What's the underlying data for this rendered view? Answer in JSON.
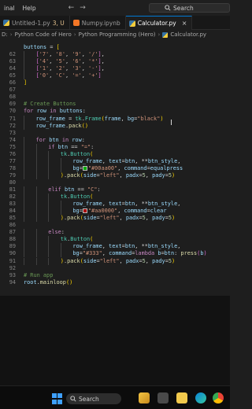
{
  "titlebar": {
    "menu": [
      "inal",
      "Help"
    ],
    "search_label": "Search"
  },
  "tabs": [
    {
      "label": "Untitled-1.py",
      "modified": "3, U",
      "active": false,
      "type": "py"
    },
    {
      "label": "Numpy.ipynb",
      "modified": "",
      "active": false,
      "type": "nb"
    },
    {
      "label": "Calculator.py",
      "modified": "",
      "active": true,
      "type": "py"
    }
  ],
  "tab_close_glyph": "×",
  "breadcrumb": [
    "D:",
    "Python Code of Hero",
    "Python Programming (Hero)",
    "Calculator.py"
  ],
  "colors": {
    "equal_swatch": "#00aa00",
    "clear_swatch": "#aa0000"
  },
  "code_lines": [
    {
      "n": "",
      "indent": 0,
      "tokens": [
        [
          "var",
          "buttons"
        ],
        [
          "op",
          " = "
        ],
        [
          "br1",
          "["
        ]
      ]
    },
    {
      "n": "62",
      "indent": 1,
      "tokens": [
        [
          "br2",
          "["
        ],
        [
          "str",
          "'7'"
        ],
        [
          "op",
          ", "
        ],
        [
          "str",
          "'8'"
        ],
        [
          "op",
          ", "
        ],
        [
          "str",
          "'9'"
        ],
        [
          "op",
          ", "
        ],
        [
          "str",
          "'/'"
        ],
        [
          "br2",
          "]"
        ],
        [
          "op",
          ","
        ]
      ]
    },
    {
      "n": "63",
      "indent": 1,
      "tokens": [
        [
          "br2",
          "["
        ],
        [
          "str",
          "'4'"
        ],
        [
          "op",
          ", "
        ],
        [
          "str",
          "'5'"
        ],
        [
          "op",
          ", "
        ],
        [
          "str",
          "'6'"
        ],
        [
          "op",
          ", "
        ],
        [
          "str",
          "'*'"
        ],
        [
          "br2",
          "]"
        ],
        [
          "op",
          ","
        ]
      ]
    },
    {
      "n": "64",
      "indent": 1,
      "tokens": [
        [
          "br2",
          "["
        ],
        [
          "str",
          "'1'"
        ],
        [
          "op",
          ", "
        ],
        [
          "str",
          "'2'"
        ],
        [
          "op",
          ", "
        ],
        [
          "str",
          "'3'"
        ],
        [
          "op",
          ", "
        ],
        [
          "str",
          "'-'"
        ],
        [
          "br2",
          "]"
        ],
        [
          "op",
          ","
        ]
      ]
    },
    {
      "n": "65",
      "indent": 1,
      "tokens": [
        [
          "br2",
          "["
        ],
        [
          "str",
          "'0'"
        ],
        [
          "op",
          ", "
        ],
        [
          "str",
          "'C'"
        ],
        [
          "op",
          ", "
        ],
        [
          "str",
          "'='"
        ],
        [
          "op",
          ", "
        ],
        [
          "str",
          "'+'"
        ],
        [
          "br2",
          "]"
        ]
      ]
    },
    {
      "n": "66",
      "indent": 0,
      "tokens": [
        [
          "br1",
          "]"
        ]
      ]
    },
    {
      "n": "67",
      "indent": 0,
      "tokens": []
    },
    {
      "n": "68",
      "indent": 0,
      "tokens": []
    },
    {
      "n": "69",
      "indent": 0,
      "tokens": [
        [
          "com",
          "# Create Buttons"
        ]
      ]
    },
    {
      "n": "70",
      "indent": 0,
      "tokens": [
        [
          "kw",
          "for"
        ],
        [
          "op",
          " "
        ],
        [
          "var",
          "row"
        ],
        [
          "op",
          " "
        ],
        [
          "kw",
          "in"
        ],
        [
          "op",
          " "
        ],
        [
          "var",
          "buttons"
        ],
        [
          "op",
          ":"
        ]
      ]
    },
    {
      "n": "71",
      "indent": 1,
      "tokens": [
        [
          "var",
          "row_frame"
        ],
        [
          "op",
          " = "
        ],
        [
          "cls",
          "tk"
        ],
        [
          "op",
          "."
        ],
        [
          "cls",
          "Frame"
        ],
        [
          "br1",
          "("
        ],
        [
          "var",
          "frame"
        ],
        [
          "op",
          ", "
        ],
        [
          "var",
          "bg"
        ],
        [
          "op",
          "="
        ],
        [
          "str",
          "\"black\""
        ],
        [
          "br1",
          ")"
        ]
      ]
    },
    {
      "n": "72",
      "indent": 1,
      "tokens": [
        [
          "var",
          "row_frame"
        ],
        [
          "op",
          "."
        ],
        [
          "fn",
          "pack"
        ],
        [
          "br1",
          "()"
        ]
      ]
    },
    {
      "n": "73",
      "indent": 0,
      "tokens": []
    },
    {
      "n": "74",
      "indent": 1,
      "tokens": [
        [
          "kw",
          "for"
        ],
        [
          "op",
          " "
        ],
        [
          "var",
          "btn"
        ],
        [
          "op",
          " "
        ],
        [
          "kw",
          "in"
        ],
        [
          "op",
          " "
        ],
        [
          "var",
          "row"
        ],
        [
          "op",
          ":"
        ]
      ]
    },
    {
      "n": "75",
      "indent": 2,
      "tokens": [
        [
          "kw",
          "if"
        ],
        [
          "op",
          " "
        ],
        [
          "var",
          "btn"
        ],
        [
          "op",
          " == "
        ],
        [
          "str",
          "\"=\""
        ],
        [
          "op",
          ":"
        ]
      ]
    },
    {
      "n": "76",
      "indent": 3,
      "tokens": [
        [
          "cls",
          "tk"
        ],
        [
          "op",
          "."
        ],
        [
          "cls",
          "Button"
        ],
        [
          "br1",
          "("
        ]
      ]
    },
    {
      "n": "77",
      "indent": 4,
      "tokens": [
        [
          "var",
          "row_frame"
        ],
        [
          "op",
          ", "
        ],
        [
          "var",
          "text"
        ],
        [
          "op",
          "="
        ],
        [
          "var",
          "btn"
        ],
        [
          "op",
          ", **"
        ],
        [
          "var",
          "btn_style"
        ],
        [
          "op",
          ","
        ]
      ]
    },
    {
      "n": "78",
      "indent": 4,
      "tokens": [
        [
          "var",
          "bg"
        ],
        [
          "op",
          "="
        ],
        [
          "swatch",
          "equal_swatch"
        ],
        [
          "str",
          "\"#00aa00\""
        ],
        [
          "op",
          ", "
        ],
        [
          "var",
          "command"
        ],
        [
          "op",
          "="
        ],
        [
          "var",
          "equalpress"
        ]
      ]
    },
    {
      "n": "79",
      "indent": 3,
      "tokens": [
        [
          "br1",
          ")"
        ],
        [
          "op",
          "."
        ],
        [
          "fn",
          "pack"
        ],
        [
          "br1",
          "("
        ],
        [
          "var",
          "side"
        ],
        [
          "op",
          "="
        ],
        [
          "str",
          "\"left\""
        ],
        [
          "op",
          ", "
        ],
        [
          "var",
          "padx"
        ],
        [
          "op",
          "="
        ],
        [
          "num",
          "5"
        ],
        [
          "op",
          ", "
        ],
        [
          "var",
          "pady"
        ],
        [
          "op",
          "="
        ],
        [
          "num",
          "5"
        ],
        [
          "br1",
          ")"
        ]
      ]
    },
    {
      "n": "80",
      "indent": 0,
      "tokens": []
    },
    {
      "n": "81",
      "indent": 2,
      "tokens": [
        [
          "kw",
          "elif"
        ],
        [
          "op",
          " "
        ],
        [
          "var",
          "btn"
        ],
        [
          "op",
          " == "
        ],
        [
          "str",
          "\"C\""
        ],
        [
          "op",
          ":"
        ]
      ]
    },
    {
      "n": "82",
      "indent": 3,
      "tokens": [
        [
          "cls",
          "tk"
        ],
        [
          "op",
          "."
        ],
        [
          "cls",
          "Button"
        ],
        [
          "br1",
          "("
        ]
      ]
    },
    {
      "n": "83",
      "indent": 4,
      "tokens": [
        [
          "var",
          "row_frame"
        ],
        [
          "op",
          ", "
        ],
        [
          "var",
          "text"
        ],
        [
          "op",
          "="
        ],
        [
          "var",
          "btn"
        ],
        [
          "op",
          ", **"
        ],
        [
          "var",
          "btn_style"
        ],
        [
          "op",
          ","
        ]
      ]
    },
    {
      "n": "84",
      "indent": 4,
      "tokens": [
        [
          "var",
          "bg"
        ],
        [
          "op",
          "="
        ],
        [
          "swatch",
          "clear_swatch"
        ],
        [
          "str",
          "\"#aa0000\""
        ],
        [
          "op",
          ", "
        ],
        [
          "var",
          "command"
        ],
        [
          "op",
          "="
        ],
        [
          "var",
          "clear"
        ]
      ]
    },
    {
      "n": "85",
      "indent": 3,
      "tokens": [
        [
          "br1",
          ")"
        ],
        [
          "op",
          "."
        ],
        [
          "fn",
          "pack"
        ],
        [
          "br1",
          "("
        ],
        [
          "var",
          "side"
        ],
        [
          "op",
          "="
        ],
        [
          "str",
          "\"left\""
        ],
        [
          "op",
          ", "
        ],
        [
          "var",
          "padx"
        ],
        [
          "op",
          "="
        ],
        [
          "num",
          "5"
        ],
        [
          "op",
          ", "
        ],
        [
          "var",
          "pady"
        ],
        [
          "op",
          "="
        ],
        [
          "num",
          "5"
        ],
        [
          "br1",
          ")"
        ]
      ]
    },
    {
      "n": "86",
      "indent": 0,
      "tokens": []
    },
    {
      "n": "87",
      "indent": 2,
      "tokens": [
        [
          "kw",
          "else"
        ],
        [
          "op",
          ":"
        ]
      ]
    },
    {
      "n": "88",
      "indent": 3,
      "tokens": [
        [
          "cls",
          "tk"
        ],
        [
          "op",
          "."
        ],
        [
          "cls",
          "Button"
        ],
        [
          "br1",
          "("
        ]
      ]
    },
    {
      "n": "89",
      "indent": 4,
      "tokens": [
        [
          "var",
          "row_frame"
        ],
        [
          "op",
          ", "
        ],
        [
          "var",
          "text"
        ],
        [
          "op",
          "="
        ],
        [
          "var",
          "btn"
        ],
        [
          "op",
          ", **"
        ],
        [
          "var",
          "btn_style"
        ],
        [
          "op",
          ","
        ]
      ]
    },
    {
      "n": "90",
      "indent": 4,
      "tokens": [
        [
          "var",
          "bg"
        ],
        [
          "op",
          "="
        ],
        [
          "str",
          "\"#333\""
        ],
        [
          "op",
          ", "
        ],
        [
          "var",
          "command"
        ],
        [
          "op",
          "="
        ],
        [
          "kw",
          "lambda"
        ],
        [
          "op",
          " "
        ],
        [
          "var",
          "b"
        ],
        [
          "op",
          "="
        ],
        [
          "var",
          "btn"
        ],
        [
          "op",
          ": "
        ],
        [
          "fn",
          "press"
        ],
        [
          "br2",
          "("
        ],
        [
          "var",
          "b"
        ],
        [
          "br2",
          ")"
        ]
      ]
    },
    {
      "n": "91",
      "indent": 3,
      "tokens": [
        [
          "br1",
          ")"
        ],
        [
          "op",
          "."
        ],
        [
          "fn",
          "pack"
        ],
        [
          "br1",
          "("
        ],
        [
          "var",
          "side"
        ],
        [
          "op",
          "="
        ],
        [
          "str",
          "\"left\""
        ],
        [
          "op",
          ", "
        ],
        [
          "var",
          "padx"
        ],
        [
          "op",
          "="
        ],
        [
          "num",
          "5"
        ],
        [
          "op",
          ", "
        ],
        [
          "var",
          "pady"
        ],
        [
          "op",
          "="
        ],
        [
          "num",
          "5"
        ],
        [
          "br1",
          ")"
        ]
      ]
    },
    {
      "n": "92",
      "indent": 0,
      "tokens": []
    },
    {
      "n": "93",
      "indent": 0,
      "tokens": [
        [
          "com",
          "# Run app"
        ]
      ]
    },
    {
      "n": "94",
      "indent": 0,
      "tokens": [
        [
          "var",
          "root"
        ],
        [
          "op",
          "."
        ],
        [
          "fn",
          "mainloop"
        ],
        [
          "br1",
          "()"
        ]
      ]
    }
  ],
  "taskbar": {
    "search_label": "Search",
    "apps": [
      "start",
      "files",
      "edge",
      "store",
      "vscode",
      "chrome"
    ]
  }
}
